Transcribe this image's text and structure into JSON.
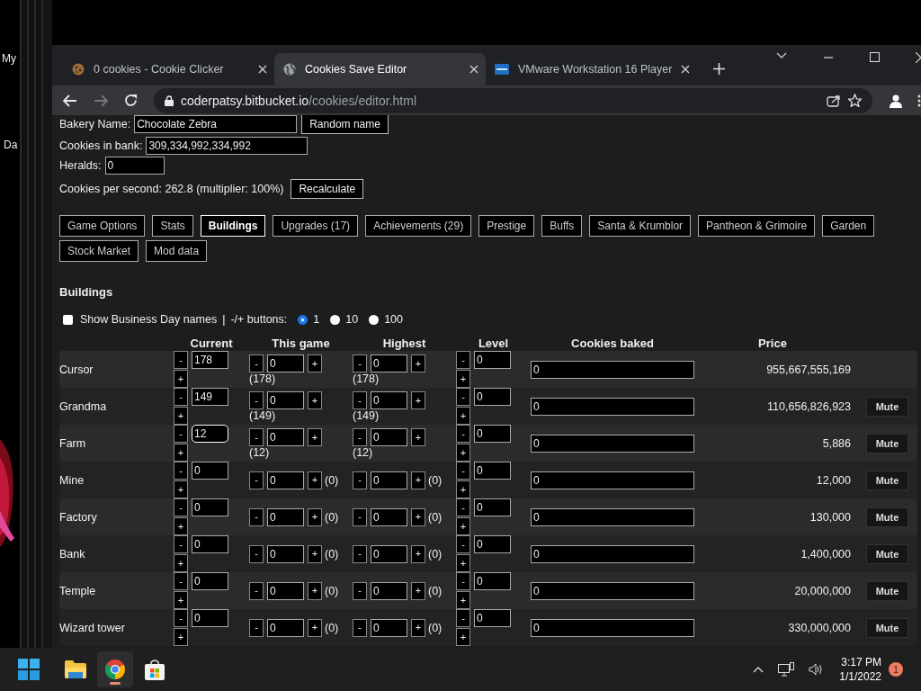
{
  "desktop": {
    "labels": [
      "My",
      "Da"
    ]
  },
  "browser": {
    "tabs": [
      {
        "title": "0 cookies - Cookie Clicker",
        "selected": false
      },
      {
        "title": "Cookies Save Editor",
        "selected": true
      },
      {
        "title": "VMware Workstation 16 Player",
        "selected": false
      }
    ],
    "address": {
      "host": "coderpatsy.bitbucket.io",
      "path": "/cookies/editor.html"
    }
  },
  "form": {
    "bakery_name": {
      "label": "Bakery Name:",
      "value": "Chocolate Zebra"
    },
    "random_button": "Random name",
    "cookies_in_bank": {
      "label": "Cookies in bank:",
      "value": "309,334,992,334,992"
    },
    "heralds": {
      "label": "Heralds:",
      "value": "0"
    },
    "cps_text": "Cookies per second: 262.8 (multiplier: 100%)",
    "recalculate_button": "Recalculate"
  },
  "section_tabs": [
    {
      "label": "Game Options",
      "selected": false
    },
    {
      "label": "Stats",
      "selected": false
    },
    {
      "label": "Buildings",
      "selected": true
    },
    {
      "label": "Upgrades (17)",
      "selected": false
    },
    {
      "label": "Achievements (29)",
      "selected": false
    },
    {
      "label": "Prestige",
      "selected": false
    },
    {
      "label": "Buffs",
      "selected": false
    },
    {
      "label": "Santa & Krumblor",
      "selected": false
    },
    {
      "label": "Pantheon & Grimoire",
      "selected": false
    },
    {
      "label": "Garden",
      "selected": false
    },
    {
      "label": "Stock Market",
      "selected": false
    },
    {
      "label": "Mod data",
      "selected": false
    }
  ],
  "section_title": "Buildings",
  "options": {
    "business_day": {
      "label": "Show Business Day names",
      "checked": false
    },
    "separator": "|",
    "buttons_label": "-/+ buttons:",
    "radios": [
      {
        "label": "1",
        "selected": true
      },
      {
        "label": "10",
        "selected": false
      },
      {
        "label": "100",
        "selected": false
      }
    ]
  },
  "table": {
    "columns": [
      "Current",
      "This game",
      "Highest",
      "Level",
      "Cookies baked",
      "Price"
    ],
    "minus": "-",
    "plus": "+",
    "rows": [
      {
        "kind": "stacked",
        "name": "Cursor",
        "current": "178",
        "focused": false,
        "this_game": "0",
        "this_game_total": "(178)",
        "highest": "0",
        "highest_total": "(178)",
        "level": "0",
        "cookies_baked": "0",
        "price": "955,667,555,169"
      },
      {
        "kind": "stacked",
        "name": "Grandma",
        "current": "149",
        "focused": false,
        "this_game": "0",
        "this_game_total": "(149)",
        "highest": "0",
        "highest_total": "(149)",
        "level": "0",
        "cookies_baked": "0",
        "price": "110,656,826,923",
        "mute": "Mute"
      },
      {
        "kind": "stacked",
        "name": "Farm",
        "current": "12",
        "focused": true,
        "this_game": "0",
        "this_game_total": "(12)",
        "highest": "0",
        "highest_total": "(12)",
        "level": "0",
        "cookies_baked": "0",
        "price": "5,886",
        "mute": "Mute"
      },
      {
        "kind": "inline",
        "name": "Mine",
        "current": "0",
        "focused": false,
        "this_game": "0",
        "this_game_total": "(0)",
        "highest": "0",
        "highest_total": "(0)",
        "level": "0",
        "cookies_baked": "0",
        "price": "12,000",
        "mute": "Mute"
      },
      {
        "kind": "inline",
        "name": "Factory",
        "current": "0",
        "focused": false,
        "this_game": "0",
        "this_game_total": "(0)",
        "highest": "0",
        "highest_total": "(0)",
        "level": "0",
        "cookies_baked": "0",
        "price": "130,000",
        "mute": "Mute"
      },
      {
        "kind": "inline",
        "name": "Bank",
        "current": "0",
        "focused": false,
        "this_game": "0",
        "this_game_total": "(0)",
        "highest": "0",
        "highest_total": "(0)",
        "level": "0",
        "cookies_baked": "0",
        "price": "1,400,000",
        "mute": "Mute"
      },
      {
        "kind": "inline",
        "name": "Temple",
        "current": "0",
        "focused": false,
        "this_game": "0",
        "this_game_total": "(0)",
        "highest": "0",
        "highest_total": "(0)",
        "level": "0",
        "cookies_baked": "0",
        "price": "20,000,000",
        "mute": "Mute"
      },
      {
        "kind": "inline",
        "name": "Wizard tower",
        "current": "0",
        "focused": false,
        "this_game": "0",
        "this_game_total": "(0)",
        "highest": "0",
        "highest_total": "(0)",
        "level": "0",
        "cookies_baked": "0",
        "price": "330,000,000",
        "mute": "Mute"
      }
    ]
  },
  "taskbar": {
    "time": "3:17 PM",
    "date": "1/1/2022",
    "notifications": "1"
  }
}
